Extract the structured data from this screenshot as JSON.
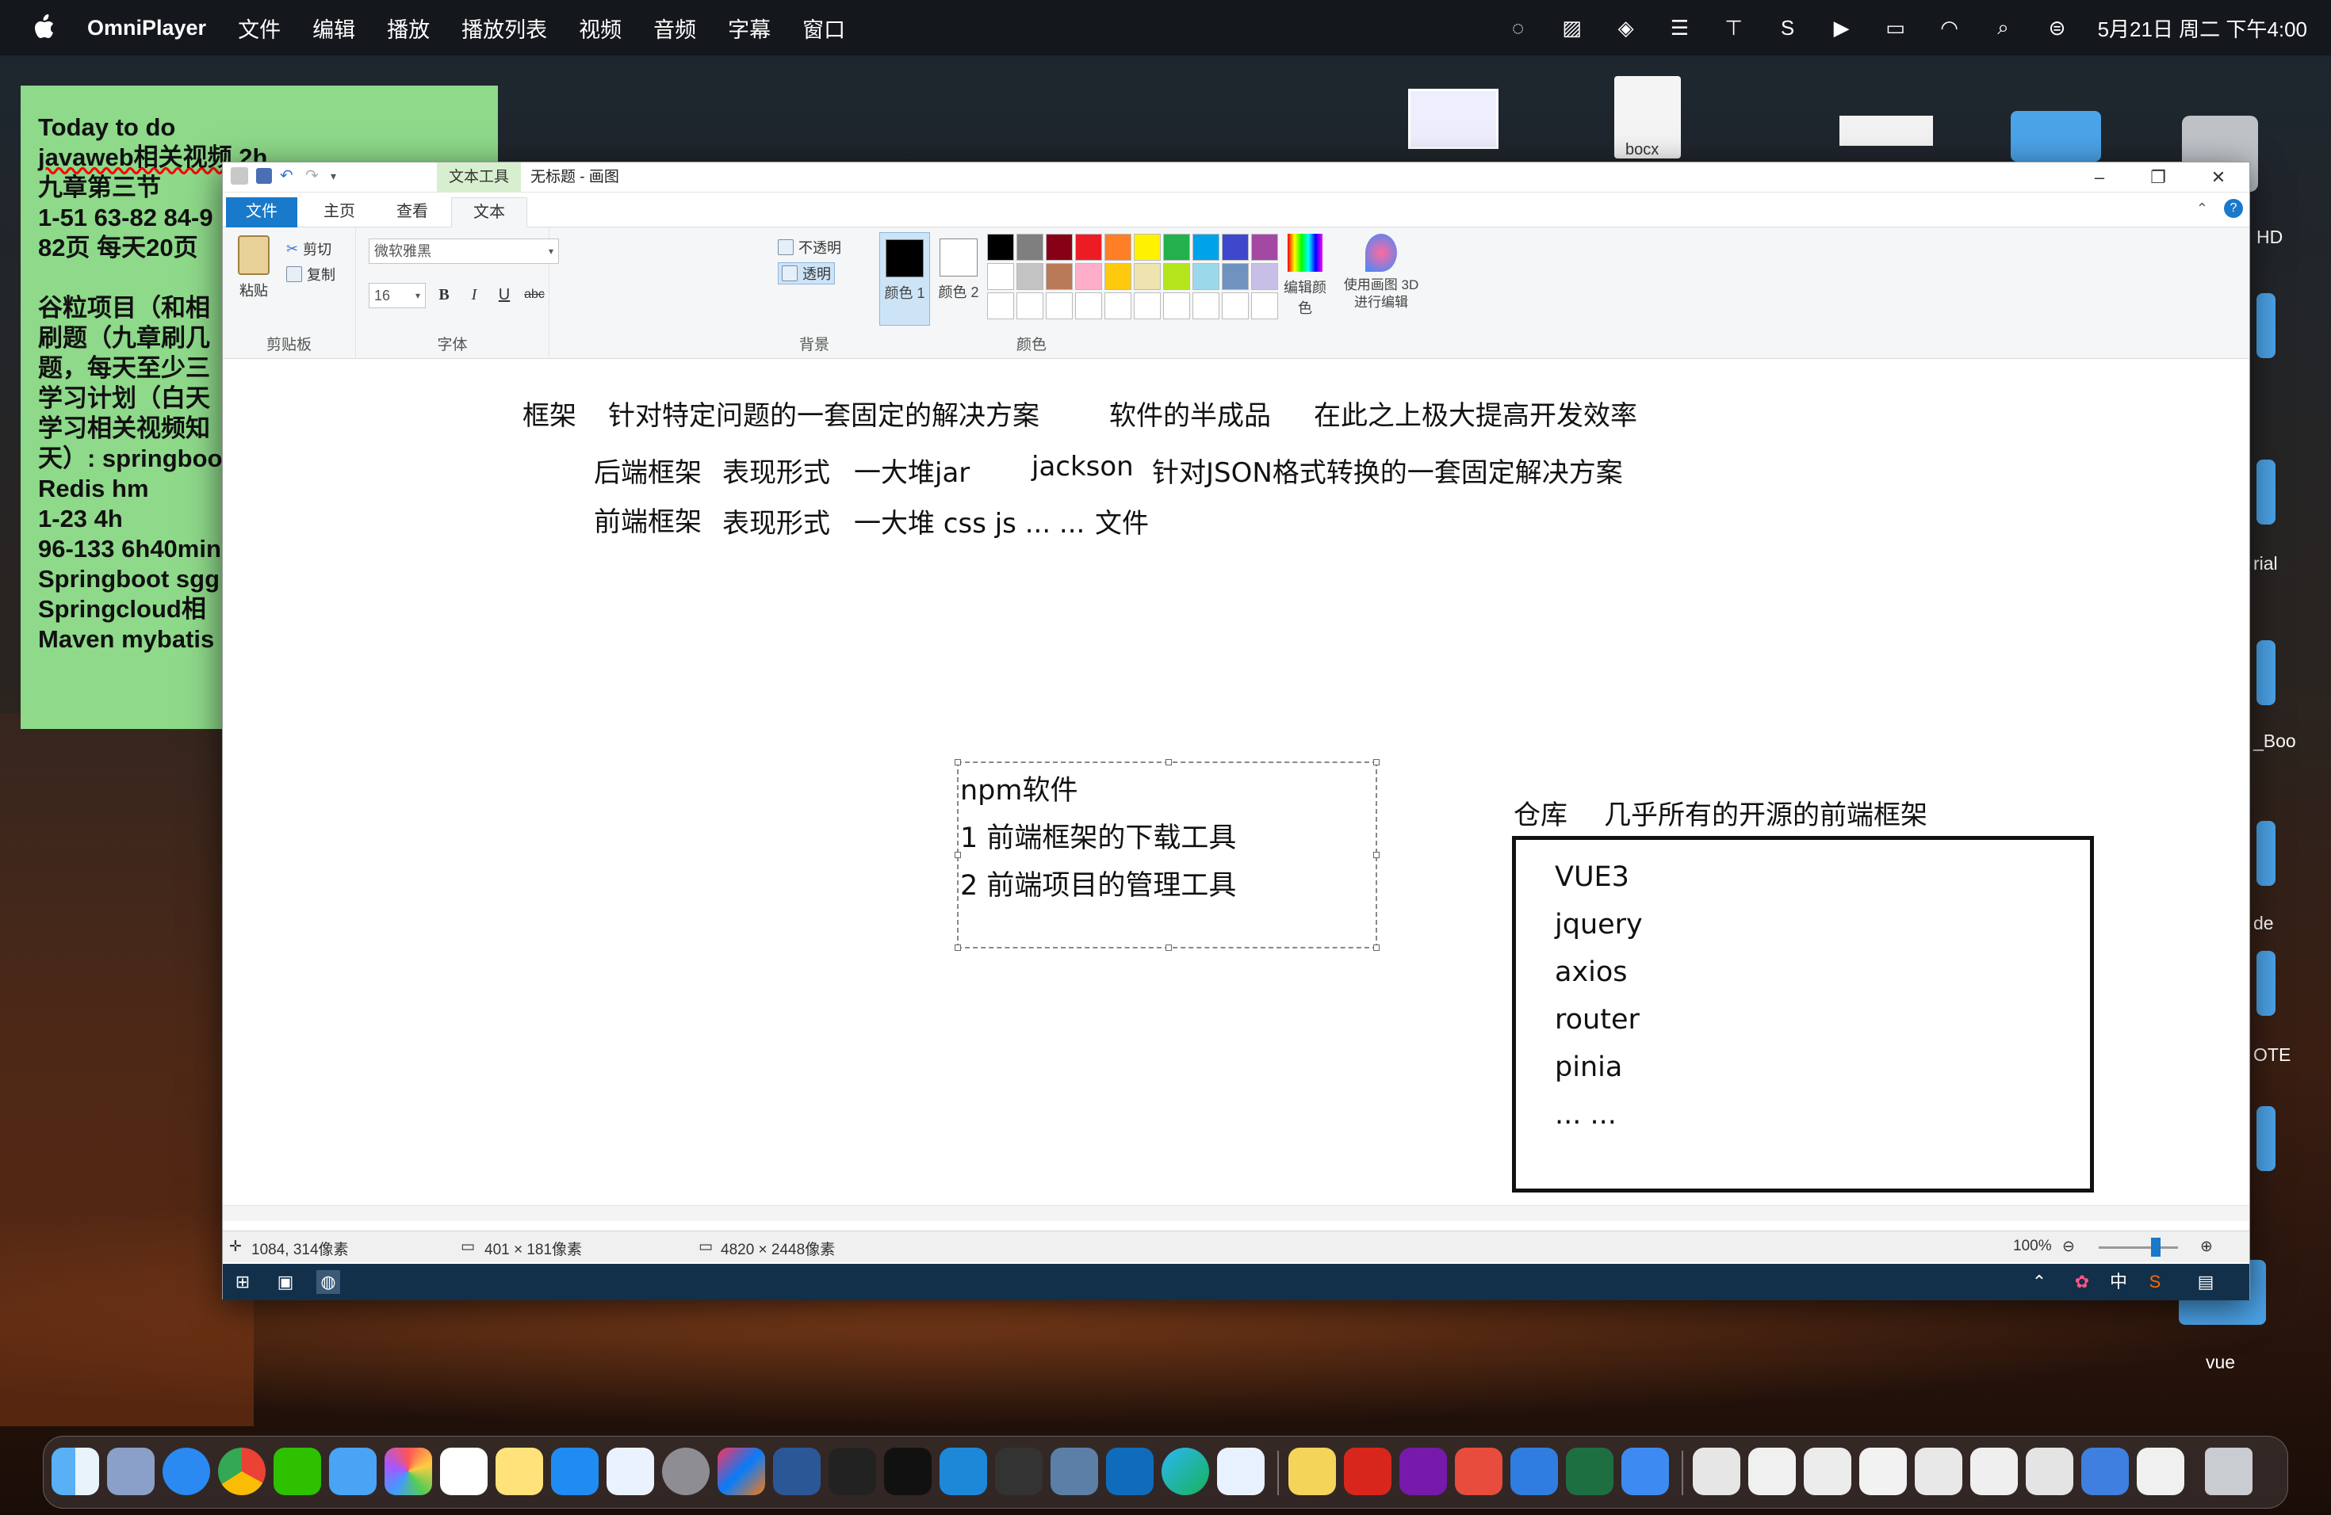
{
  "menubar": {
    "app_name": "OmniPlayer",
    "menus": [
      "文件",
      "编辑",
      "播放",
      "播放列表",
      "视频",
      "音频",
      "字幕",
      "窗口"
    ],
    "clock": "5月21日 周二 下午4:00"
  },
  "sticky_note": {
    "lines": [
      "Today to do",
      "javaweb相关视频 2h",
      "九章第三节",
      "1-51 63-82 84-9",
      "82页 每天20页",
      "",
      "谷粒项目（和相",
      "刷题（九章刷几",
      "题，每天至少三",
      "学习计划（白天",
      "学习相关视频知",
      "天）: springboo",
      "Redis hm",
      "1-23 4h",
      "96-133 6h40min",
      "Springboot sgg",
      "Springcloud相",
      "Maven mybatis"
    ]
  },
  "desktop": {
    "labels": [
      "HD",
      "rial",
      "_Boo",
      "de",
      "OTE",
      "vue",
      "bocx"
    ]
  },
  "paint": {
    "context_tab": "文本工具",
    "title": "无标题 - 画图",
    "tabs": [
      "文件",
      "主页",
      "查看",
      "文本"
    ],
    "clipboard": {
      "paste": "粘贴",
      "cut": "剪切",
      "copy": "复制",
      "label": "剪贴板"
    },
    "font": {
      "name": "微软雅黑",
      "size": "16",
      "bold": "B",
      "italic": "I",
      "underline": "U",
      "strike": "abc",
      "label": "字体"
    },
    "background": {
      "opaque": "不透明",
      "transparent": "透明",
      "label": "背景"
    },
    "colors": {
      "color1": "颜色 1",
      "color2": "颜色 2",
      "edit": "编辑颜色",
      "paint3d": "使用画图 3D 进行编辑",
      "label": "颜色",
      "color1_value": "#000000",
      "color2_value": "#ffffff",
      "palette": [
        "#000000",
        "#7f7f7f",
        "#880015",
        "#ed1c24",
        "#ff7f27",
        "#fff200",
        "#22b14c",
        "#00a2e8",
        "#3f48cc",
        "#a349a4",
        "#ffffff",
        "#c3c3c3",
        "#b97a57",
        "#ffaec9",
        "#ffc90e",
        "#efe4b0",
        "#b5e61d",
        "#99d9ea",
        "#7092be",
        "#c8bfe7",
        "#ffffff",
        "#ffffff",
        "#ffffff",
        "#ffffff",
        "#ffffff",
        "#ffffff",
        "#ffffff",
        "#ffffff",
        "#ffffff",
        "#ffffff"
      ]
    },
    "canvas": {
      "line1": [
        "框架",
        "针对特定问题的一套固定的解决方案",
        "软件的半成品",
        "在此之上极大提高开发效率"
      ],
      "line2": [
        "后端框架",
        "表现形式",
        "一大堆jar",
        "jackson",
        "针对JSON格式转换的一套固定解决方案"
      ],
      "line3": [
        "前端框架",
        "表现形式",
        "一大堆 css js ... ...",
        "文件"
      ],
      "npm": [
        "npm软件",
        "1 前端框架的下载工具",
        "2 前端项目的管理工具"
      ],
      "repo_title": [
        "仓库",
        "几乎所有的开源的前端框架"
      ],
      "repo_items": [
        "VUE3",
        "jquery",
        "axios",
        "router",
        "pinia",
        "... ..."
      ]
    },
    "status": {
      "cursor": "1084, 314像素",
      "selection": "401 × 181像素",
      "canvas_size": "4820 × 2448像素",
      "zoom": "100%"
    }
  }
}
